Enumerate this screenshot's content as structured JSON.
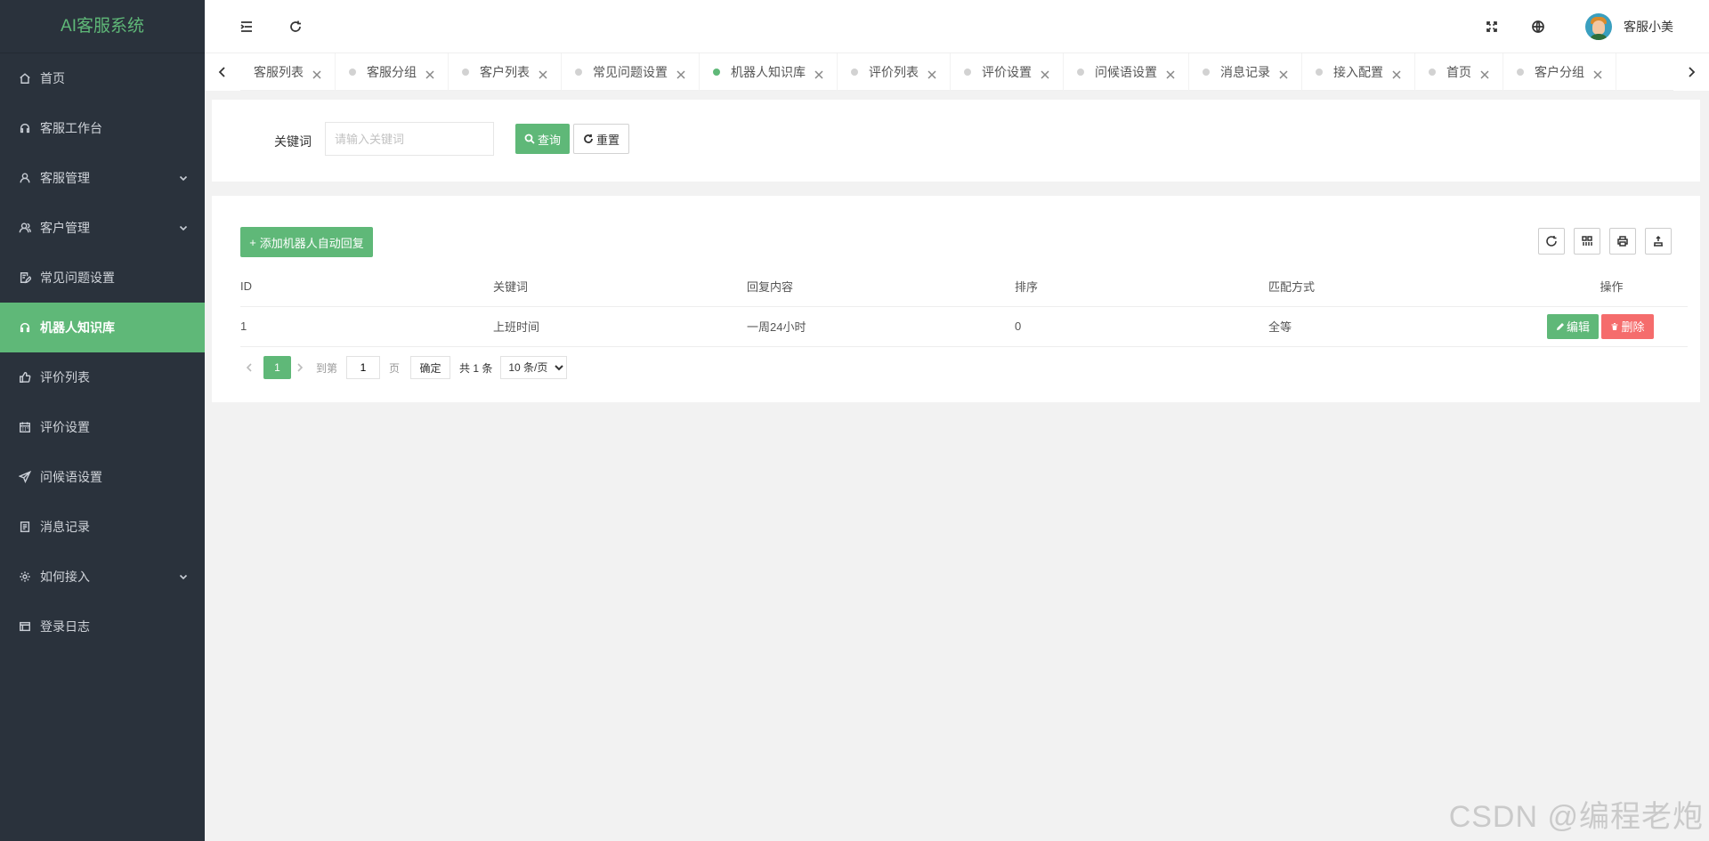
{
  "app": {
    "title": "AI客服系统"
  },
  "sidebar": {
    "items": [
      {
        "label": "首页",
        "icon": "home-icon"
      },
      {
        "label": "客服工作台",
        "icon": "headset-icon"
      },
      {
        "label": "客服管理",
        "icon": "user-icon",
        "expandable": true
      },
      {
        "label": "客户管理",
        "icon": "users-icon",
        "expandable": true
      },
      {
        "label": "常见问题设置",
        "icon": "edit-doc-icon"
      },
      {
        "label": "机器人知识库",
        "icon": "headset-icon",
        "active": true
      },
      {
        "label": "评价列表",
        "icon": "thumbs-up-icon"
      },
      {
        "label": "评价设置",
        "icon": "calendar-icon"
      },
      {
        "label": "问候语设置",
        "icon": "send-icon"
      },
      {
        "label": "消息记录",
        "icon": "document-icon"
      },
      {
        "label": "如何接入",
        "icon": "gear-icon",
        "expandable": true
      },
      {
        "label": "登录日志",
        "icon": "log-icon"
      }
    ]
  },
  "header": {
    "username": "客服小美"
  },
  "tabs": [
    {
      "label": "客服列表",
      "dot": false
    },
    {
      "label": "客服分组",
      "dot": true
    },
    {
      "label": "客户列表",
      "dot": true
    },
    {
      "label": "常见问题设置",
      "dot": true
    },
    {
      "label": "机器人知识库",
      "dot": true,
      "active": true
    },
    {
      "label": "评价列表",
      "dot": true
    },
    {
      "label": "评价设置",
      "dot": true
    },
    {
      "label": "问候语设置",
      "dot": true
    },
    {
      "label": "消息记录",
      "dot": true
    },
    {
      "label": "接入配置",
      "dot": true
    },
    {
      "label": "首页",
      "dot": true
    },
    {
      "label": "客户分组",
      "dot": true
    }
  ],
  "search": {
    "label": "关键词",
    "placeholder": "请输入关键词",
    "query_label": "查询",
    "reset_label": "重置"
  },
  "toolbar": {
    "add_label": "添加机器人自动回复"
  },
  "table": {
    "columns": [
      "ID",
      "关键词",
      "回复内容",
      "排序",
      "匹配方式",
      "操作"
    ],
    "rows": [
      {
        "id": "1",
        "keyword": "上班时间",
        "reply": "一周24小时",
        "sort": "0",
        "match": "全等"
      }
    ],
    "edit_label": "编辑",
    "delete_label": "删除"
  },
  "pager": {
    "current": "1",
    "goto_prefix": "到第",
    "goto_value": "1",
    "goto_suffix": "页",
    "confirm_label": "确定",
    "total_text": "共 1 条",
    "page_size": "10 条/页"
  },
  "watermark": "CSDN @编程老炮",
  "colors": {
    "accent": "#5fb878",
    "sidebar_bg": "#2a323c",
    "danger": "#f56c6c"
  }
}
